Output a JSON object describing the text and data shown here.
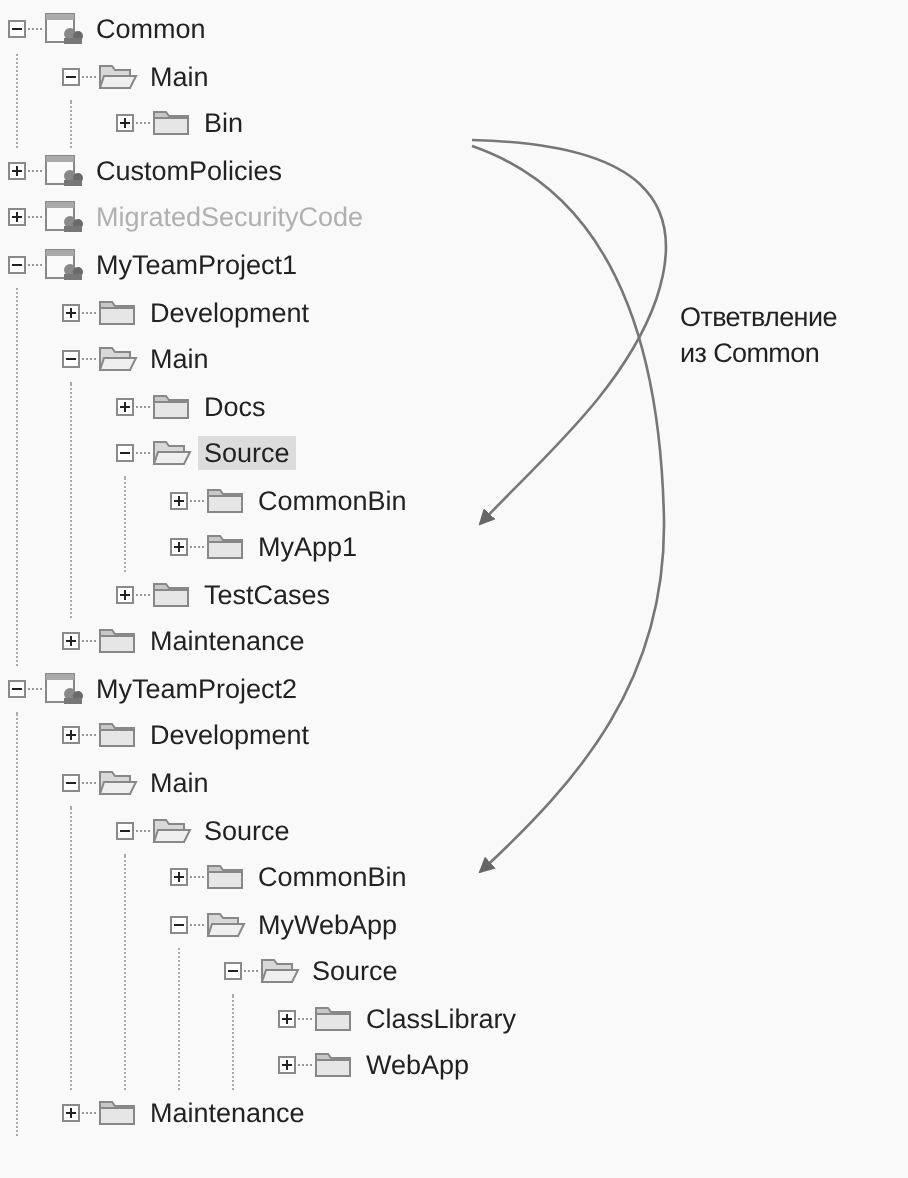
{
  "tree": [
    {
      "label": "Common",
      "kind": "project",
      "expanded": true,
      "selected": false,
      "disabled": false,
      "children": [
        {
          "label": "Main",
          "kind": "folder",
          "expanded": true,
          "selected": false,
          "disabled": false,
          "children": [
            {
              "label": "Bin",
              "kind": "folder",
              "expanded": false,
              "selected": false,
              "disabled": false
            }
          ]
        }
      ]
    },
    {
      "label": "CustomPolicies",
      "kind": "project",
      "expanded": false,
      "selected": false,
      "disabled": false
    },
    {
      "label": "MigratedSecurityCode",
      "kind": "project",
      "expanded": false,
      "selected": false,
      "disabled": true
    },
    {
      "label": "MyTeamProject1",
      "kind": "project",
      "expanded": true,
      "selected": false,
      "disabled": false,
      "children": [
        {
          "label": "Development",
          "kind": "folder",
          "expanded": false,
          "selected": false,
          "disabled": false
        },
        {
          "label": "Main",
          "kind": "folder",
          "expanded": true,
          "selected": false,
          "disabled": false,
          "children": [
            {
              "label": "Docs",
              "kind": "folder",
              "expanded": false,
              "selected": false,
              "disabled": false
            },
            {
              "label": "Source",
              "kind": "folder",
              "expanded": true,
              "selected": true,
              "disabled": false,
              "children": [
                {
                  "label": "CommonBin",
                  "kind": "folder",
                  "expanded": false,
                  "selected": false,
                  "disabled": false
                },
                {
                  "label": "MyApp1",
                  "kind": "folder",
                  "expanded": false,
                  "selected": false,
                  "disabled": false
                }
              ]
            },
            {
              "label": "TestCases",
              "kind": "folder",
              "expanded": false,
              "selected": false,
              "disabled": false
            }
          ]
        },
        {
          "label": "Maintenance",
          "kind": "folder",
          "expanded": false,
          "selected": false,
          "disabled": false
        }
      ]
    },
    {
      "label": "MyTeamProject2",
      "kind": "project",
      "expanded": true,
      "selected": false,
      "disabled": false,
      "children": [
        {
          "label": "Development",
          "kind": "folder",
          "expanded": false,
          "selected": false,
          "disabled": false
        },
        {
          "label": "Main",
          "kind": "folder",
          "expanded": true,
          "selected": false,
          "disabled": false,
          "children": [
            {
              "label": "Source",
              "kind": "folder",
              "expanded": true,
              "selected": false,
              "disabled": false,
              "children": [
                {
                  "label": "CommonBin",
                  "kind": "folder",
                  "expanded": false,
                  "selected": false,
                  "disabled": false
                },
                {
                  "label": "MyWebApp",
                  "kind": "folder",
                  "expanded": true,
                  "selected": false,
                  "disabled": false,
                  "children": [
                    {
                      "label": "Source",
                      "kind": "folder",
                      "expanded": true,
                      "selected": false,
                      "disabled": false,
                      "children": [
                        {
                          "label": "ClassLibrary",
                          "kind": "folder",
                          "expanded": false,
                          "selected": false,
                          "disabled": false
                        },
                        {
                          "label": "WebApp",
                          "kind": "folder",
                          "expanded": false,
                          "selected": false,
                          "disabled": false
                        }
                      ]
                    }
                  ]
                }
              ]
            }
          ]
        },
        {
          "label": "Maintenance",
          "kind": "folder",
          "expanded": false,
          "selected": false,
          "disabled": false
        }
      ]
    }
  ],
  "annotation": {
    "lines": [
      "Ответвление",
      "из Common"
    ]
  }
}
